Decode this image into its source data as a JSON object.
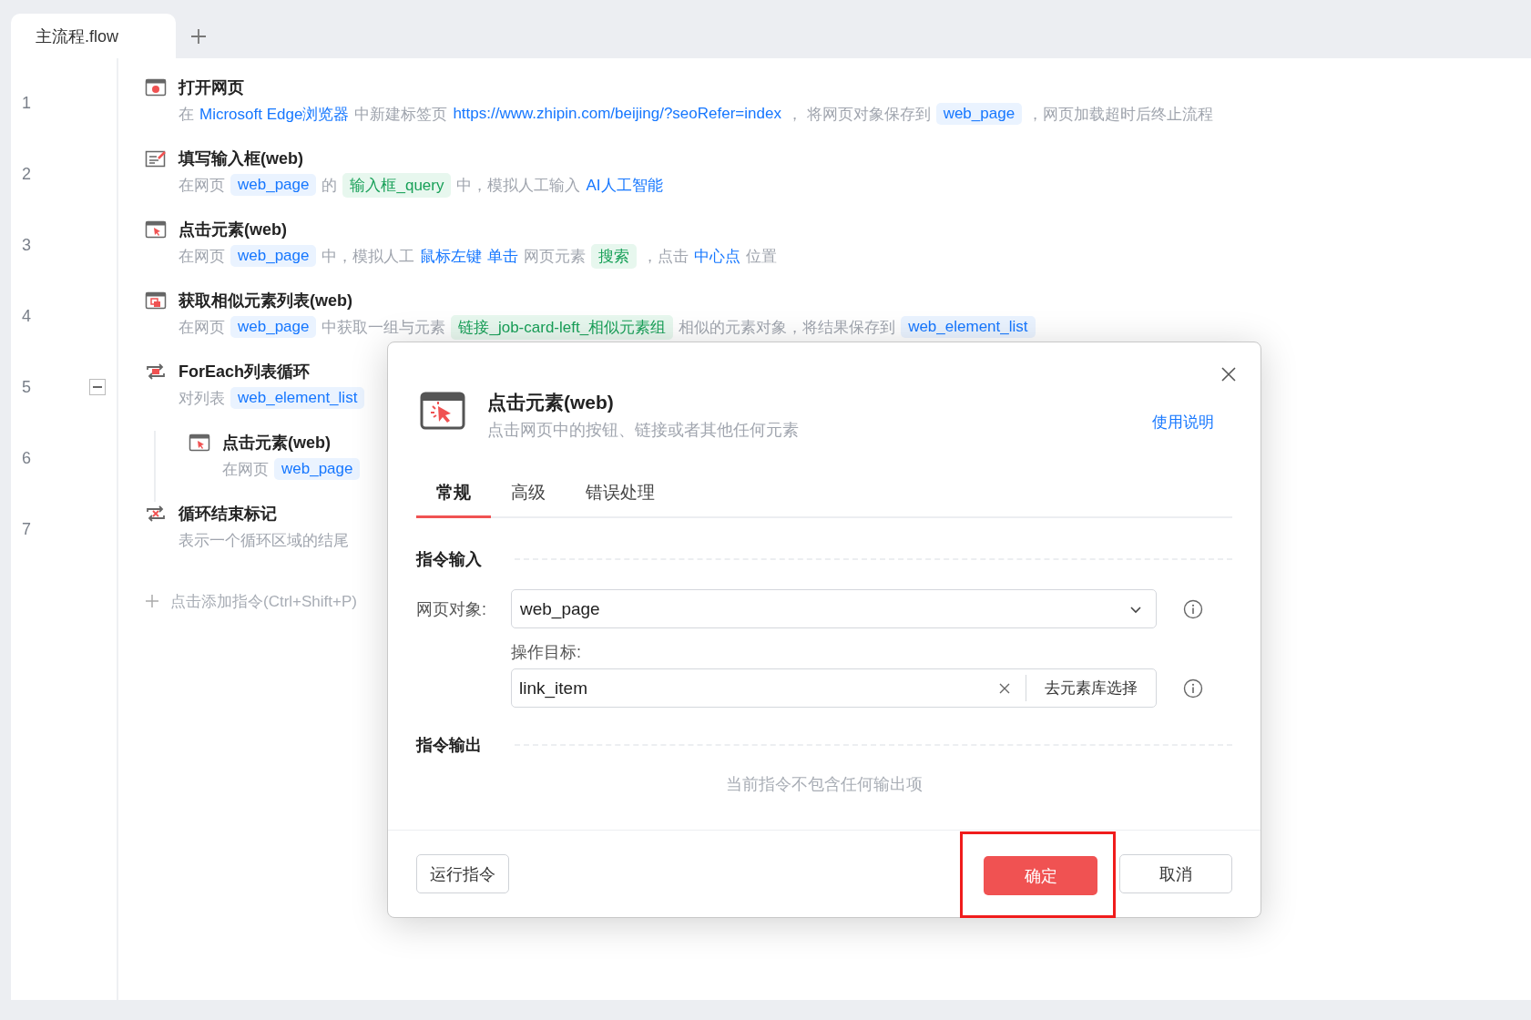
{
  "tabs": [
    {
      "label": "主流程.flow",
      "selected": true
    }
  ],
  "steps": [
    {
      "line": "1",
      "kind": "open",
      "title": "打开网页",
      "desc": [
        {
          "kind": "text",
          "text": "在"
        },
        {
          "kind": "link",
          "text": "Microsoft Edge浏览器"
        },
        {
          "kind": "text",
          "text": "中新建标签页"
        },
        {
          "kind": "link",
          "text": "https://www.zhipin.com/beijing/?seoRefer=index"
        },
        {
          "kind": "text",
          "text": "，  将网页对象保存到"
        },
        {
          "kind": "var",
          "text": "web_page"
        },
        {
          "kind": "text",
          "text": "，网页加载超时后终止流程"
        }
      ]
    },
    {
      "line": "2",
      "kind": "fill",
      "title": "填写输入框(web)",
      "desc": [
        {
          "kind": "text",
          "text": "在网页"
        },
        {
          "kind": "var",
          "text": "web_page"
        },
        {
          "kind": "text",
          "text": "的"
        },
        {
          "kind": "elem",
          "text": "输入框_query"
        },
        {
          "kind": "text",
          "text": "中，模拟人工输入"
        },
        {
          "kind": "link",
          "text": "AI人工智能"
        }
      ]
    },
    {
      "line": "3",
      "kind": "click",
      "title": "点击元素(web)",
      "desc": [
        {
          "kind": "text",
          "text": "在网页"
        },
        {
          "kind": "var",
          "text": "web_page"
        },
        {
          "kind": "text",
          "text": "中，模拟人工"
        },
        {
          "kind": "link",
          "text": "鼠标左键"
        },
        {
          "kind": "link",
          "text": "单击"
        },
        {
          "kind": "text",
          "text": "网页元素"
        },
        {
          "kind": "elem",
          "text": "搜索"
        },
        {
          "kind": "text",
          "text": "，点击"
        },
        {
          "kind": "link",
          "text": "中心点"
        },
        {
          "kind": "text",
          "text": "位置"
        }
      ]
    },
    {
      "line": "4",
      "kind": "list",
      "title": "获取相似元素列表(web)",
      "desc": [
        {
          "kind": "text",
          "text": "在网页"
        },
        {
          "kind": "var",
          "text": "web_page"
        },
        {
          "kind": "text",
          "text": "中获取一组与元素"
        },
        {
          "kind": "elem",
          "text": "链接_job-card-left_相似元素组"
        },
        {
          "kind": "text",
          "text": "相似的元素对象，将结果保存到"
        },
        {
          "kind": "var",
          "text": "web_element_list"
        }
      ]
    },
    {
      "line": "5",
      "kind": "loop",
      "title": "ForEach列表循环",
      "expanded": true,
      "desc": [
        {
          "kind": "text",
          "text": "对列表"
        },
        {
          "kind": "var",
          "text": "web_element_list"
        }
      ],
      "children": [
        {
          "line": "6",
          "kind": "click",
          "title": "点击元素(web)",
          "desc": [
            {
              "kind": "text",
              "text": "在网页"
            },
            {
              "kind": "var",
              "text": "web_page"
            }
          ]
        }
      ]
    },
    {
      "line": "7",
      "kind": "loopend",
      "title": "循环结束标记",
      "desc": [
        {
          "kind": "text",
          "text": "表示一个循环区域的结尾"
        }
      ]
    }
  ],
  "add_instruction": "点击添加指令(Ctrl+Shift+P)",
  "dialog": {
    "title": "点击元素(web)",
    "description": "点击网页中的按钮、链接或者其他任何元素",
    "help_link": "使用说明",
    "tabs": [
      {
        "label": "常规",
        "selected": true
      },
      {
        "label": "高级",
        "selected": false
      },
      {
        "label": "错误处理",
        "selected": false
      }
    ],
    "input_section": "指令输入",
    "fields": [
      {
        "kind": "select",
        "label": "网页对象:",
        "value": "web_page"
      },
      {
        "kind": "picker",
        "label": "操作目标:",
        "value": "link_item",
        "button": "去元素库选择"
      }
    ],
    "output_section": "指令输出",
    "output_empty": "当前指令不包含任何输出项",
    "buttons": [
      {
        "kind": "run",
        "label": "运行指令",
        "highlighted": false
      },
      {
        "kind": "primary",
        "label": "确定",
        "highlighted": true
      },
      {
        "kind": "cancel",
        "label": "取消",
        "highlighted": false
      }
    ]
  }
}
